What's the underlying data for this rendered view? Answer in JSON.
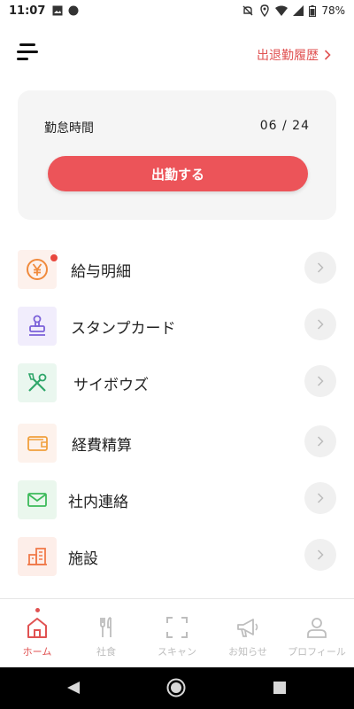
{
  "status_bar": {
    "time": "11:07",
    "battery": "78%"
  },
  "header": {
    "history_link": "出退勤履歴"
  },
  "attendance": {
    "label": "勤怠時間",
    "date": "06 / 24",
    "clock_in_button": "出勤する"
  },
  "menu": [
    {
      "label": "給与明細",
      "icon": "yen-icon",
      "color": "#f08a3c",
      "bg": "#fdf1ec",
      "badge": true
    },
    {
      "label": "スタンプカード",
      "icon": "stamp-icon",
      "color": "#7b61d9",
      "bg": "#f1edfc",
      "badge": false
    },
    {
      "label": "サイボウズ",
      "icon": "tools-icon",
      "color": "#2fa66a",
      "bg": "#eaf7ef",
      "badge": false
    },
    {
      "label": "経費精算",
      "icon": "wallet-icon",
      "color": "#f0a03c",
      "bg": "#fdf2ec",
      "badge": false
    },
    {
      "label": "社内連絡",
      "icon": "mail-icon",
      "color": "#3cba5a",
      "bg": "#eaf7ed",
      "badge": false
    },
    {
      "label": "施設",
      "icon": "building-icon",
      "color": "#f07a4a",
      "bg": "#fdeee9",
      "badge": false
    }
  ],
  "bottom_nav": [
    {
      "label": "ホーム",
      "icon": "home-icon",
      "active": true
    },
    {
      "label": "社食",
      "icon": "cutlery-icon",
      "active": false
    },
    {
      "label": "スキャン",
      "icon": "scan-icon",
      "active": false
    },
    {
      "label": "お知らせ",
      "icon": "megaphone-icon",
      "active": false
    },
    {
      "label": "プロフィール",
      "icon": "profile-icon",
      "active": false
    }
  ],
  "colors": {
    "accent": "#ec5459",
    "link": "#e05252",
    "inactive": "#bdbdbd"
  }
}
